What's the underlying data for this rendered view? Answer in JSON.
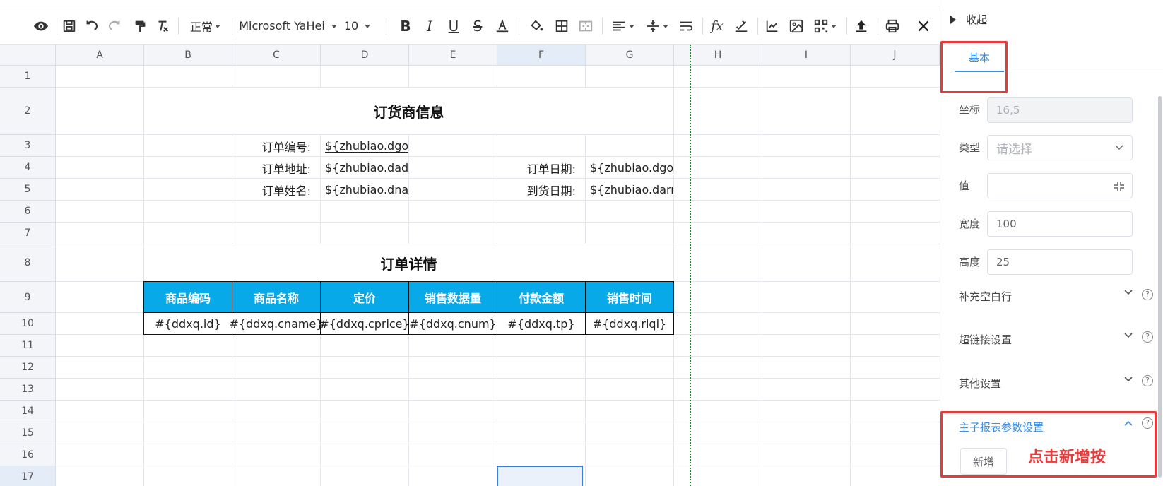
{
  "toolbar": {
    "font_style": "正常",
    "font_name": "Microsoft YaHei",
    "font_size": "10"
  },
  "sheet": {
    "columns": [
      "A",
      "B",
      "C",
      "D",
      "E",
      "F",
      "G",
      "H",
      "I",
      "J"
    ],
    "rows": [
      "1",
      "2",
      "3",
      "4",
      "5",
      "6",
      "7",
      "8",
      "9",
      "10",
      "11",
      "12",
      "13",
      "14",
      "15",
      "16",
      "17"
    ],
    "section1_title": "订货商信息",
    "section2_title": "订单详情",
    "labels": {
      "order_no": "订单编号:",
      "order_addr": "订单地址:",
      "order_name": "订单姓名:",
      "order_date": "订单日期:",
      "arrive_date": "到货日期:"
    },
    "values": {
      "order_no": "${zhubiao.dgo",
      "order_addr": "${zhubiao.dad",
      "order_name": "${zhubiao.dna",
      "order_date": "${zhubiao.dgo",
      "arrive_date": "${zhubiao.darr"
    },
    "table_headers": [
      "商品编码",
      "商品名称",
      "定价",
      "销售数据量",
      "付款金额",
      "销售时间"
    ],
    "table_row": [
      "#{ddxq.id}",
      "#{ddxq.cname}",
      "#{ddxq.cprice}",
      "#{ddxq.cnum}",
      "#{ddxq.tp}",
      "#{ddxq.riqi}"
    ],
    "header_color": "#07a9e9"
  },
  "panel": {
    "collapse_label": "收起",
    "tab_basic": "基本",
    "coord_label": "坐标",
    "coord_value": "16,5",
    "type_label": "类型",
    "type_placeholder": "请选择",
    "value_label": "值",
    "width_label": "宽度",
    "width_value": "100",
    "height_label": "高度",
    "height_value": "25",
    "sections": [
      "补充空白行",
      "超链接设置",
      "其他设置"
    ],
    "master_child_section": "主子报表参数设置",
    "add_button": "新增",
    "annotation": "点击新增按",
    "accent_color": "#3a8ee6",
    "highlight_color": "#e83b3b"
  }
}
